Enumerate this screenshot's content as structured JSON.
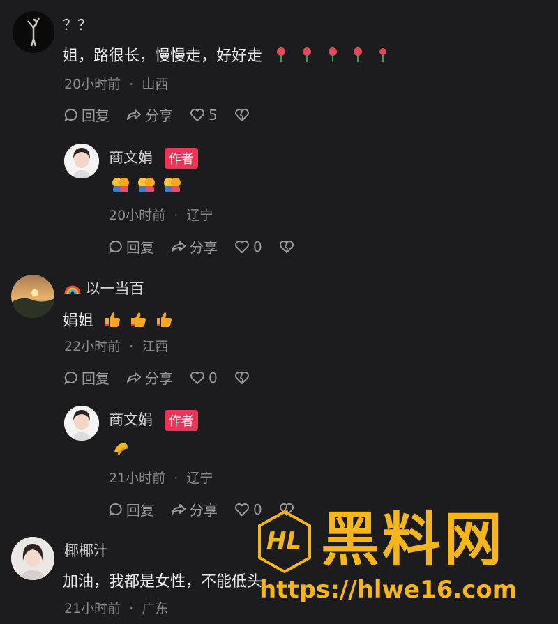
{
  "comments": [
    {
      "author": "？？",
      "text": "姐，路很长，慢慢走，好好走",
      "emoji": [
        "rose-icon",
        "rose-icon",
        "rose-icon",
        "rose-icon",
        "rose-icon"
      ],
      "time": "20小时前",
      "location": "山西",
      "reply_label": "回复",
      "share_label": "分享",
      "likes": "5"
    },
    {
      "author": "商文娟",
      "badge": "作者",
      "text": "",
      "emoji": [
        "hug-icon",
        "hug-icon",
        "hug-icon"
      ],
      "time": "20小时前",
      "location": "辽宁",
      "reply_label": "回复",
      "share_label": "分享",
      "likes": "0"
    },
    {
      "author": "以一当百",
      "author_icon": "rainbow-icon",
      "text": "娟姐",
      "emoji": [
        "thumbs-up-icon",
        "thumbs-up-icon",
        "thumbs-up-icon"
      ],
      "time": "22小时前",
      "location": "江西",
      "reply_label": "回复",
      "share_label": "分享",
      "likes": "0"
    },
    {
      "author": "商文娟",
      "badge": "作者",
      "text": "",
      "emoji": [
        "bow-icon"
      ],
      "time": "21小时前",
      "location": "辽宁",
      "reply_label": "回复",
      "share_label": "分享",
      "likes": "0"
    },
    {
      "author": "椰椰汁",
      "text": "加油，我都是女性，不能低头",
      "time": "21小时前",
      "location": "广东"
    }
  ],
  "separator": "·",
  "watermark": {
    "logo_text": "HL",
    "title": "黑料网",
    "url": "https://hlwe16.com"
  },
  "colors": {
    "background": "#1c1c1e",
    "badge": "#ec3458",
    "watermark": "#f5b51c"
  }
}
